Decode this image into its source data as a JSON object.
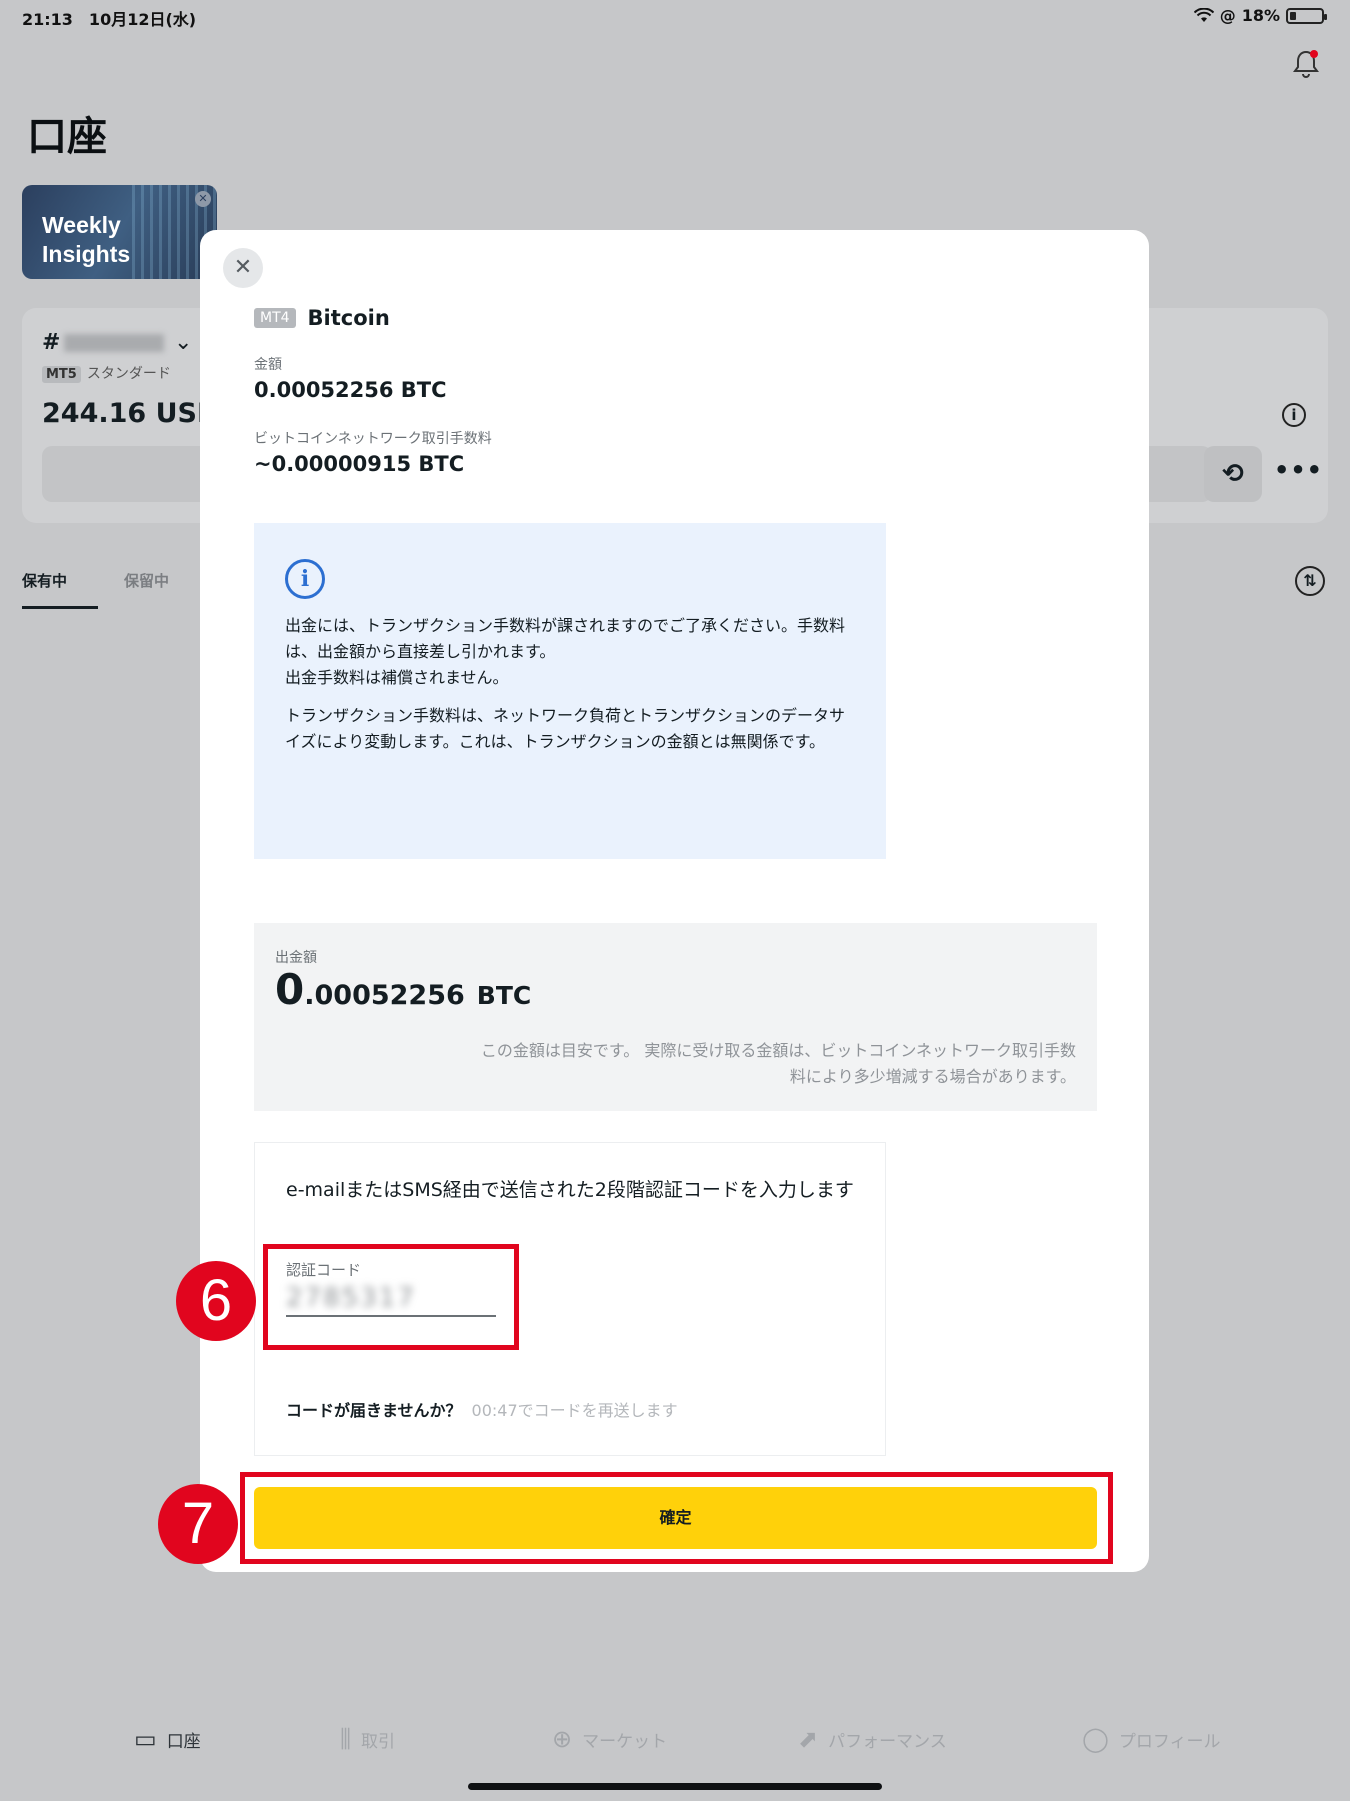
{
  "status_bar": {
    "time_date": "21:13　10月12日(水)",
    "battery_text": "18%"
  },
  "page": {
    "title": "口座"
  },
  "banner": {
    "text": "Weekly\nInsights"
  },
  "account": {
    "number_prefix": "#",
    "platform_badge": "MT5",
    "account_type": "スタンダード",
    "balance": "244.16 USD"
  },
  "tabs": [
    {
      "label": "保有中",
      "active": true
    },
    {
      "label": "保留中",
      "active": false
    }
  ],
  "modal": {
    "platform_badge": "MT4",
    "title": "Bitcoin",
    "amount_label": "金額",
    "amount_value": "0.00052256 BTC",
    "fee_label": "ビットコインネットワーク取引手数料",
    "fee_value": "~0.00000915 BTC",
    "info": {
      "p1": "出金には、トランザクション手数料が課されますのでご了承ください。手数料は、出金額から直接差し引かれます。",
      "p2": "出金手数料は補償されません。",
      "p3": "トランザクション手数料は、ネットワーク負荷とトランザクションのデータサイズにより変動します。これは、トランザクションの金額とは無関係です。"
    },
    "withdraw": {
      "label": "出金額",
      "integer_part": "0",
      "decimal_part": ".00052256",
      "currency": "BTC",
      "note": "この金額は目安です。 実際に受け取る金額は、ビットコインネットワーク取引手数料により多少増減する場合があります。"
    },
    "code": {
      "instruction": "e-mailまたはSMS経由で送信された2段階認証コードを入力します",
      "label": "認証コード",
      "value": "2785317",
      "resend_question": "コードが届きませんか？",
      "resend_timer": "00:47でコードを再送します"
    },
    "confirm_label": "確定"
  },
  "annotations": {
    "step6": "6",
    "step7": "7",
    "color": "#e1051e"
  },
  "bottom_nav": [
    {
      "label": "口座",
      "icon": "card-icon",
      "active": true
    },
    {
      "label": "取引",
      "icon": "bars-icon",
      "active": false
    },
    {
      "label": "マーケット",
      "icon": "globe-icon",
      "active": false
    },
    {
      "label": "パフォーマンス",
      "icon": "chart-icon",
      "active": false
    },
    {
      "label": "プロフィール",
      "icon": "person-icon",
      "active": false
    }
  ],
  "colors": {
    "accent_yellow": "#ffd10a",
    "info_blue": "#2c6fd1",
    "overlay_gray": "#c6c7c9"
  }
}
